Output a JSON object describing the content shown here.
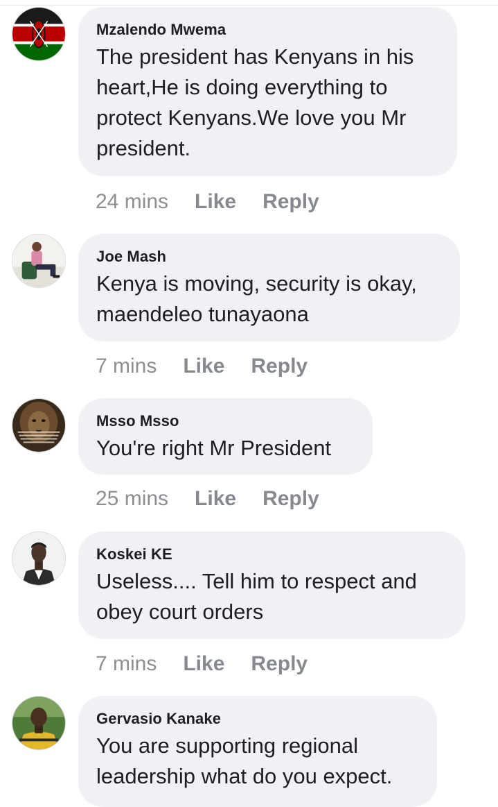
{
  "comments": [
    {
      "author": "Mzalendo Mwema",
      "text": "The president has Kenyans in his\nheart,He is doing everything to\nprotect Kenyans.We love you Mr\npresident.",
      "time": "24 mins",
      "like_label": "Like",
      "reply_label": "Reply",
      "avatar": "kenya-flag-icon"
    },
    {
      "author": "Joe Mash",
      "text": "Kenya is moving, security is okay,\nmaendeleo tunayaona",
      "time": "7 mins",
      "like_label": "Like",
      "reply_label": "Reply",
      "avatar": "seated-man-photo"
    },
    {
      "author": "Msso Msso",
      "text": "You're right Mr President",
      "time": "25 mins",
      "like_label": "Like",
      "reply_label": "Reply",
      "avatar": "lion-quote-image"
    },
    {
      "author": "Koskei KE",
      "text": "Useless.... Tell him to respect and\nobey court orders",
      "time": "7 mins",
      "like_label": "Like",
      "reply_label": "Reply",
      "avatar": "man-in-suit-photo"
    },
    {
      "author": "Gervasio Kanake",
      "text": "You are supporting regional\nleadership what do you expect.",
      "avatar": "man-outdoors-photo"
    }
  ],
  "colors": {
    "bubble": "#eff1f4",
    "text": "#1c1e21",
    "meta": "#8b8e93"
  }
}
